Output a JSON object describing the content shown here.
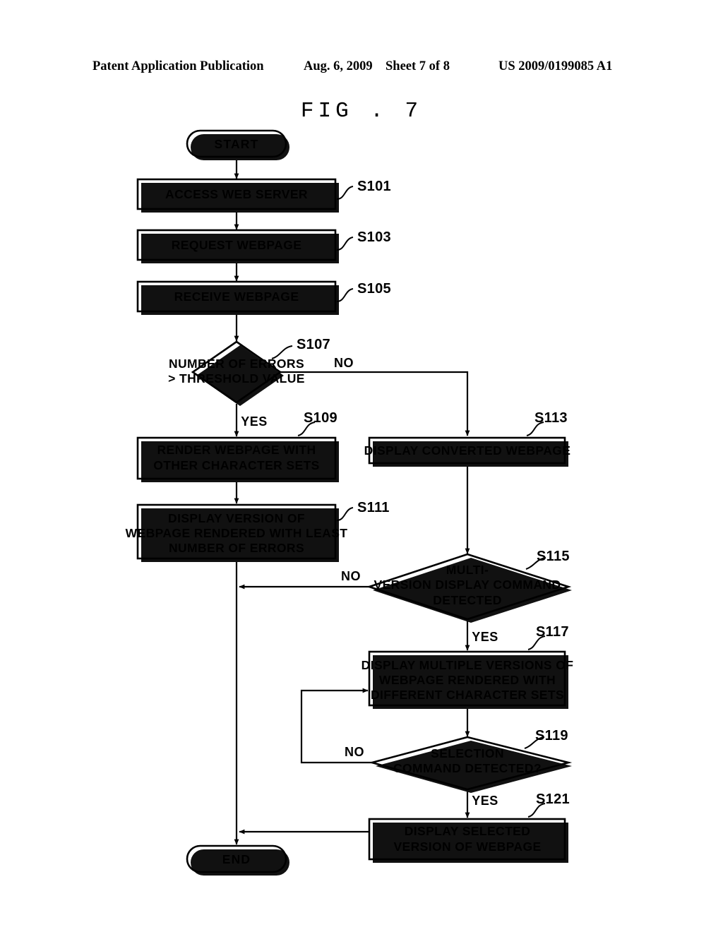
{
  "header": {
    "publication": "Patent Application Publication",
    "date": "Aug. 6, 2009",
    "sheet": "Sheet 7 of 8",
    "patent_number": "US 2009/0199085 A1"
  },
  "figure": {
    "caption": "FIG . 7"
  },
  "chart_data": {
    "type": "diagram",
    "title": "FIG . 7",
    "nodes": [
      {
        "id": "start",
        "shape": "terminator",
        "label": "START",
        "step": ""
      },
      {
        "id": "s101",
        "shape": "process",
        "label": "ACCESS WEB SERVER",
        "step": "S101"
      },
      {
        "id": "s103",
        "shape": "process",
        "label": "REQUEST WEBPAGE",
        "step": "S103"
      },
      {
        "id": "s105",
        "shape": "process",
        "label": "RECEIVE WEBPAGE",
        "step": "S105"
      },
      {
        "id": "s107",
        "shape": "decision",
        "label": "NUMBER OF ERRORS > THRESHOLD VALUE",
        "step": "S107"
      },
      {
        "id": "s109",
        "shape": "process",
        "label": "RENDER WEBPAGE WITH OTHER CHARACTER SETS",
        "step": "S109"
      },
      {
        "id": "s111",
        "shape": "process",
        "label": "DISPLAY VERSION OF WEBPAGE RENDERED WITH LEAST NUMBER OF ERRORS",
        "step": "S111"
      },
      {
        "id": "s113",
        "shape": "process",
        "label": "DISPLAY CONVERTED WEBPAGE",
        "step": "S113"
      },
      {
        "id": "s115",
        "shape": "decision",
        "label": "MULTI-VERSION DISPLAY COMMAND DETECTED",
        "step": "S115"
      },
      {
        "id": "s117",
        "shape": "process",
        "label": "DISPLAY MULTIPLE VERSIONS OF WEBPAGE RENDERED WITH DIFFERENT CHARACTER SETS",
        "step": "S117"
      },
      {
        "id": "s119",
        "shape": "decision",
        "label": "SELECTION COMMAND DETECTED?",
        "step": "S119"
      },
      {
        "id": "s121",
        "shape": "process",
        "label": "DISPLAY SELECTED VERSION OF WEBPAGE",
        "step": "S121"
      },
      {
        "id": "end",
        "shape": "terminator",
        "label": "END",
        "step": ""
      }
    ],
    "edges": [
      {
        "from": "start",
        "to": "s101",
        "label": ""
      },
      {
        "from": "s101",
        "to": "s103",
        "label": ""
      },
      {
        "from": "s103",
        "to": "s105",
        "label": ""
      },
      {
        "from": "s105",
        "to": "s107",
        "label": ""
      },
      {
        "from": "s107",
        "to": "s109",
        "label": "YES"
      },
      {
        "from": "s107",
        "to": "s113",
        "label": "NO"
      },
      {
        "from": "s109",
        "to": "s111",
        "label": ""
      },
      {
        "from": "s111",
        "to": "end",
        "label": ""
      },
      {
        "from": "s113",
        "to": "s115",
        "label": ""
      },
      {
        "from": "s115",
        "to": "end",
        "label": "NO"
      },
      {
        "from": "s115",
        "to": "s117",
        "label": "YES"
      },
      {
        "from": "s117",
        "to": "s119",
        "label": ""
      },
      {
        "from": "s119",
        "to": "s117",
        "label": "NO"
      },
      {
        "from": "s119",
        "to": "s121",
        "label": "YES"
      },
      {
        "from": "s121",
        "to": "end",
        "label": ""
      }
    ]
  },
  "nodes": {
    "start": {
      "label": "START"
    },
    "end": {
      "label": "END"
    },
    "s101": {
      "step": "S101",
      "line1": "ACCESS WEB SERVER"
    },
    "s103": {
      "step": "S103",
      "line1": "REQUEST WEBPAGE"
    },
    "s105": {
      "step": "S105",
      "line1": "RECEIVE WEBPAGE"
    },
    "s107": {
      "step": "S107",
      "line1": "NUMBER OF ERRORS",
      "line2": "> THRESHOLD VALUE"
    },
    "s109": {
      "step": "S109",
      "line1": "RENDER WEBPAGE WITH",
      "line2": "OTHER CHARACTER SETS"
    },
    "s111": {
      "step": "S111",
      "line1": "DISPLAY VERSION OF",
      "line2": "WEBPAGE RENDERED WITH LEAST",
      "line3": "NUMBER OF ERRORS"
    },
    "s113": {
      "step": "S113",
      "line1": "DISPLAY CONVERTED WEBPAGE"
    },
    "s115": {
      "step": "S115",
      "line1": "MULTI-",
      "line2": "VERSION DISPLAY COMMAND",
      "line3": "DETECTED"
    },
    "s117": {
      "step": "S117",
      "line1": "DISPLAY MULTIPLE VERSIONS OF",
      "line2": "WEBPAGE RENDERED WITH",
      "line3": "DIFFERENT CHARACTER SETS"
    },
    "s119": {
      "step": "S119",
      "line1": "SELECTION",
      "line2": "COMMAND DETECTED?"
    },
    "s121": {
      "step": "S121",
      "line1": "DISPLAY SELECTED",
      "line2": "VERSION OF WEBPAGE"
    }
  },
  "branches": {
    "s107_no": "NO",
    "s107_yes": "YES",
    "s115_no": "NO",
    "s115_yes": "YES",
    "s119_no": "NO",
    "s119_yes": "YES"
  },
  "colors": {
    "ink": "#000000",
    "paper": "#ffffff"
  }
}
